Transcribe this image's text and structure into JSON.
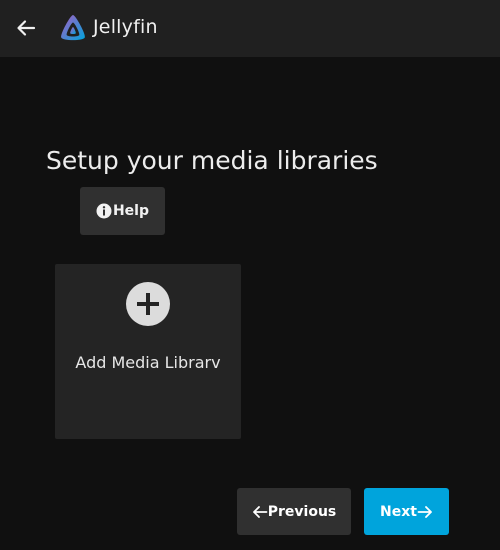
{
  "header": {
    "back_icon": "arrow-left-icon",
    "logo_icon": "jellyfin-logo-icon",
    "brand": "Jellyfin"
  },
  "main": {
    "title": "Setup your media libraries",
    "help_label": "Help",
    "help_icon": "info-icon",
    "add_library_label": "Add Media Librarv",
    "add_icon": "plus-circle-icon"
  },
  "footer": {
    "previous_label": "Previous",
    "next_label": "Next",
    "previous_icon": "arrow-left-icon",
    "next_icon": "arrow-right-icon"
  },
  "colors": {
    "background": "#101010",
    "header": "#202020",
    "card": "#242424",
    "button": "#303030",
    "accent": "#00a4dc"
  }
}
